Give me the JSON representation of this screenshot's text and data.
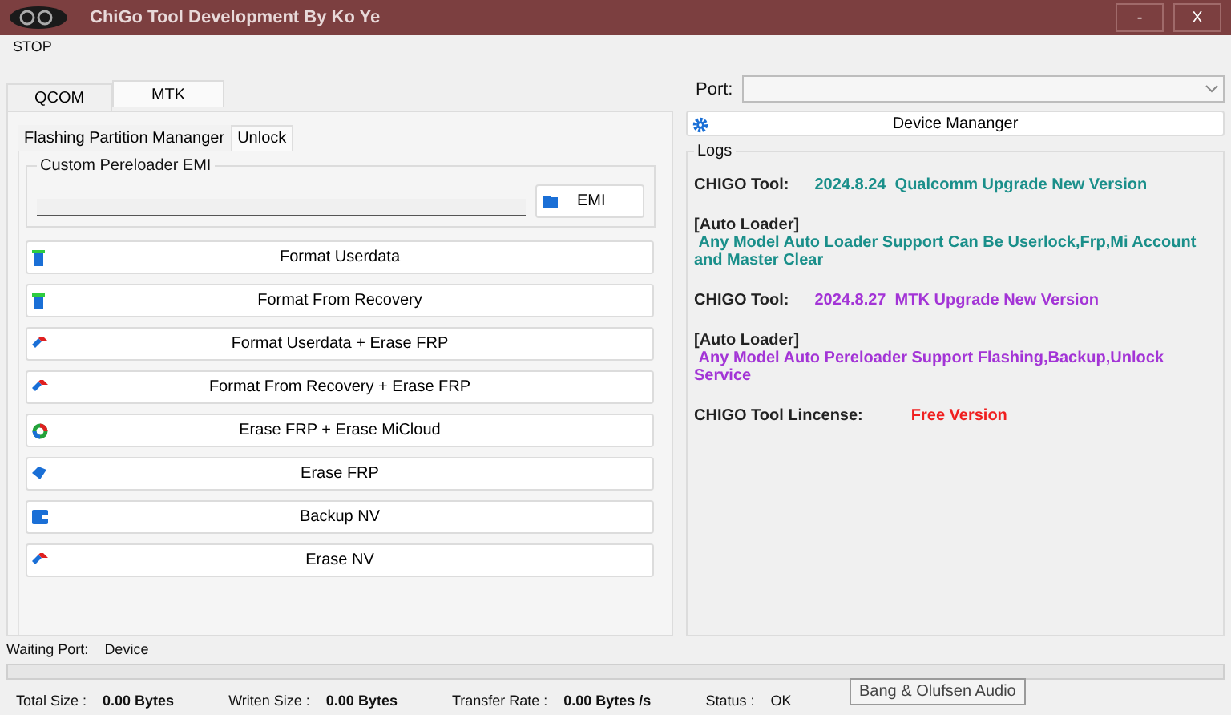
{
  "window": {
    "title": "ChiGo Tool Development By Ko Ye",
    "controls": [
      "-",
      "X"
    ]
  },
  "menu": [
    "STOP"
  ],
  "tabs": [
    {
      "label": "QCOM",
      "selected": false
    },
    {
      "label": "MTK",
      "selected": true
    }
  ],
  "subtabs": [
    {
      "label": "Flashing Partition Mananger",
      "selected": false
    },
    {
      "label": "Unlock",
      "selected": true
    }
  ],
  "emi_group": {
    "title": "Custom Pereloader EMI",
    "button": "EMI"
  },
  "actions": [
    {
      "label": "Format Userdata",
      "kind": "trash"
    },
    {
      "label": "Format From Recovery",
      "kind": "trash"
    },
    {
      "label": "Format Userdata + Erase FRP",
      "kind": "eraser"
    },
    {
      "label": "Format From Recovery + Erase FRP",
      "kind": "eraser"
    },
    {
      "label": "Erase FRP + Erase MiCloud",
      "kind": "ring"
    },
    {
      "label": "Erase FRP",
      "kind": "tag"
    },
    {
      "label": "Backup NV",
      "kind": "wallet"
    },
    {
      "label": "Erase NV",
      "kind": "eraser"
    }
  ],
  "port": {
    "label": "Port:"
  },
  "device_manager": "Device Mananger",
  "logs": {
    "title": "Logs",
    "entries": [
      {
        "kind": "inline",
        "label": "CHIGO Tool:",
        "text": "2024.8.24  Qualcomm Upgrade New Version",
        "color": "#1a8f8a"
      },
      {
        "kind": "block",
        "label": "[Auto Loader]",
        "text": " Any Model Auto Loader Support Can Be Userlock,Frp,Mi Account and Master Clear",
        "color": "#1a8f8a"
      },
      {
        "kind": "inline",
        "label": "CHIGO Tool:",
        "text": "2024.8.27  MTK Upgrade New Version",
        "color": "#a334d6"
      },
      {
        "kind": "block",
        "label": "[Auto Loader]",
        "text": " Any Model Auto Pereloader Support Flashing,Backup,Unlock Service",
        "color": "#a334d6"
      },
      {
        "kind": "license",
        "label": "CHIGO Tool Lincense:",
        "text": "Free Version",
        "color": "#f01f1f"
      }
    ]
  },
  "waiting": {
    "label": "Waiting Port:",
    "value": "Device"
  },
  "progress": {
    "level": 0
  },
  "stats": [
    {
      "label": "Total Size :",
      "value": "0.00 Bytes"
    },
    {
      "label": "Writen Size :",
      "value": "0.00 Bytes"
    },
    {
      "label": "Transfer Rate :",
      "value": "0.00 Bytes /s"
    },
    {
      "label": "Status :",
      "value": "OK",
      "kind": "plain"
    }
  ],
  "tooltip": "Bang & Olufsen Audio"
}
